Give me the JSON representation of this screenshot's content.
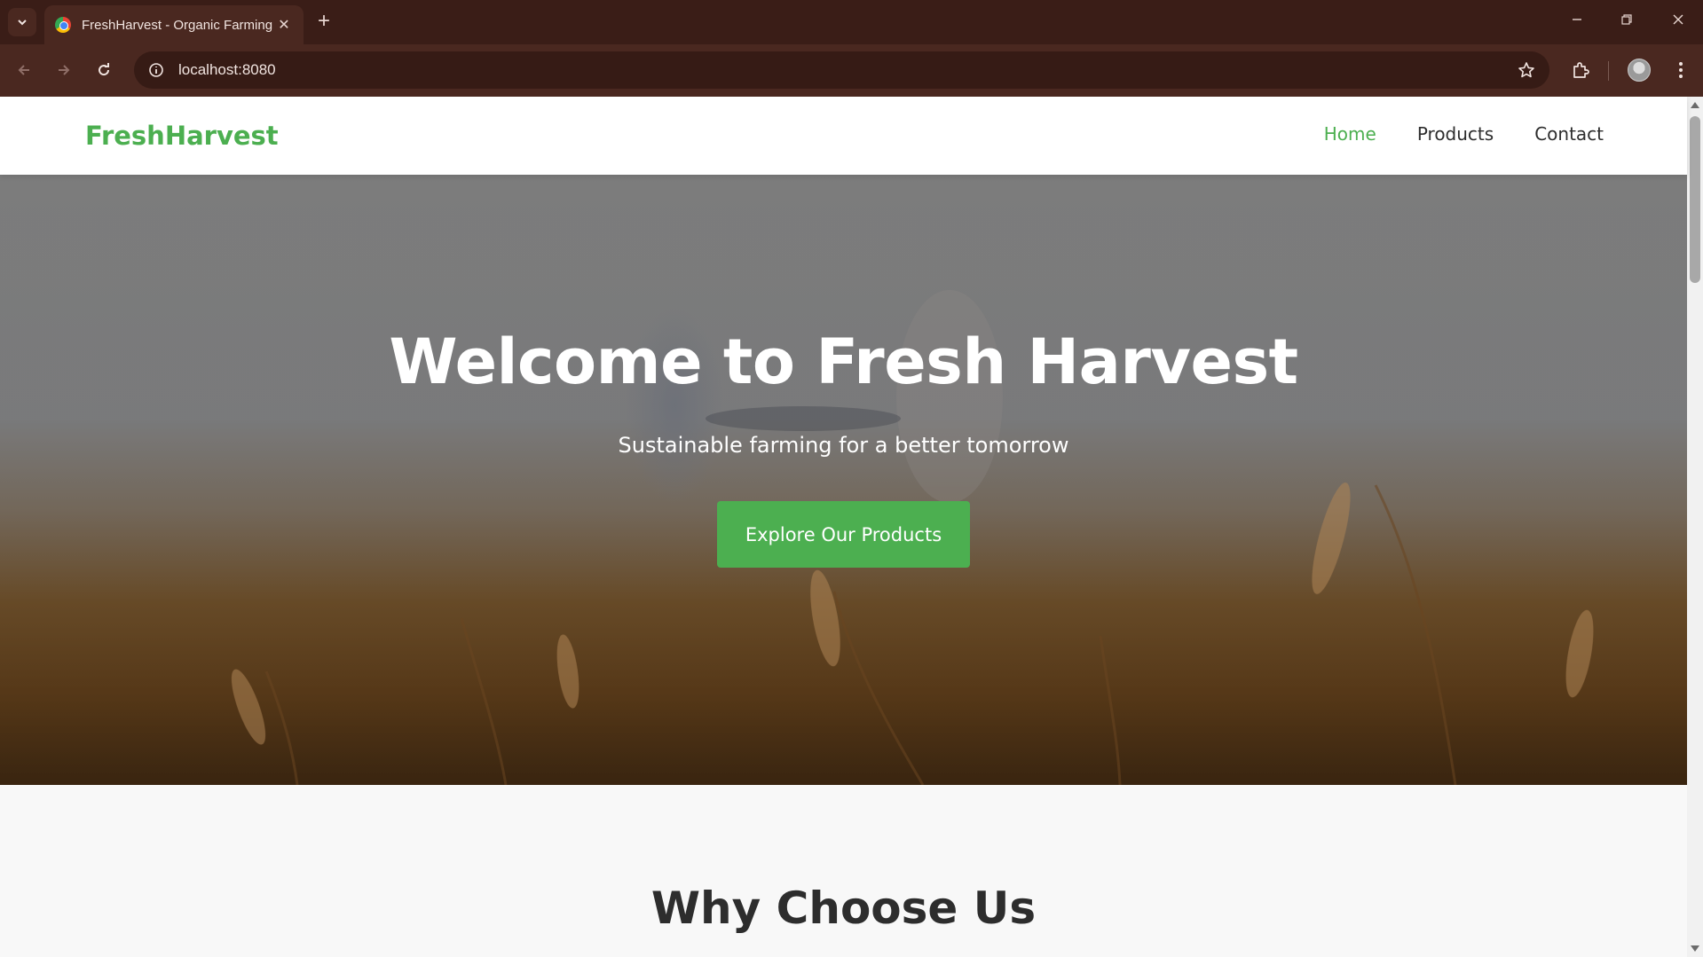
{
  "browser": {
    "tab_title": "FreshHarvest - Organic Farming",
    "url": "localhost:8080",
    "icons": {
      "tab_search": "chevron-down-icon",
      "tab_close": "close-icon",
      "new_tab": "plus-icon",
      "back": "arrow-left-icon",
      "forward": "arrow-right-icon",
      "reload": "reload-icon",
      "site_info": "info-icon",
      "bookmark": "star-icon",
      "extensions": "puzzle-icon",
      "menu": "kebab-icon"
    }
  },
  "site": {
    "brand": "FreshHarvest",
    "brand_color": "#4caf50",
    "nav": {
      "home": "Home",
      "products": "Products",
      "contact": "Contact",
      "active": "Home"
    }
  },
  "hero": {
    "title": "Welcome to Fresh Harvest",
    "subtitle": "Sustainable farming for a better tomorrow",
    "cta": "Explore Our Products"
  },
  "why": {
    "title": "Why Choose Us"
  }
}
